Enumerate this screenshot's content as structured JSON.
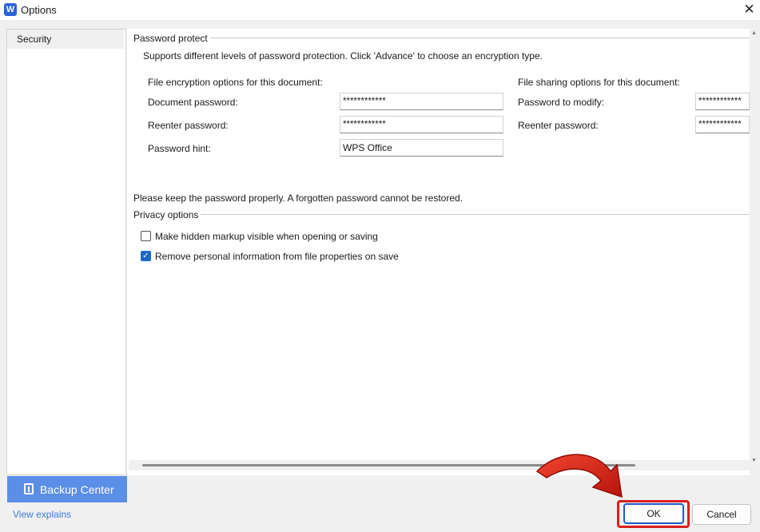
{
  "window": {
    "title": "Options",
    "app_icon_letter": "W"
  },
  "sidebar": {
    "items": [
      {
        "label": "Security",
        "selected": true
      }
    ],
    "backup_center_label": "Backup Center",
    "view_explains_label": "View explains"
  },
  "password_protect": {
    "section_title": "Password protect",
    "description": "Supports different levels of password protection. Click 'Advance' to choose an encryption type.",
    "encryption": {
      "heading": "File encryption options for this document:",
      "document_password_label": "Document password:",
      "document_password_value": "************",
      "reenter_label": "Reenter password:",
      "reenter_value": "************",
      "hint_label": "Password hint:",
      "hint_value": "WPS Office"
    },
    "sharing": {
      "heading": "File sharing options for this document:",
      "modify_label": "Password to modify:",
      "modify_value": "************",
      "reenter_label": "Reenter password:",
      "reenter_value": "************"
    },
    "warning": "Please keep the password properly. A forgotten password cannot be restored."
  },
  "privacy": {
    "section_title": "Privacy options",
    "options": [
      {
        "label": "Make hidden markup visible when opening or saving",
        "checked": false
      },
      {
        "label": "Remove personal information from file properties on save",
        "checked": true
      }
    ]
  },
  "buttons": {
    "ok_label": "OK",
    "cancel_label": "Cancel"
  },
  "colors": {
    "accent": "#1f67c7",
    "backup_bg": "#5b8ee6",
    "highlight": "#d8201a",
    "link": "#3b7dd8"
  }
}
